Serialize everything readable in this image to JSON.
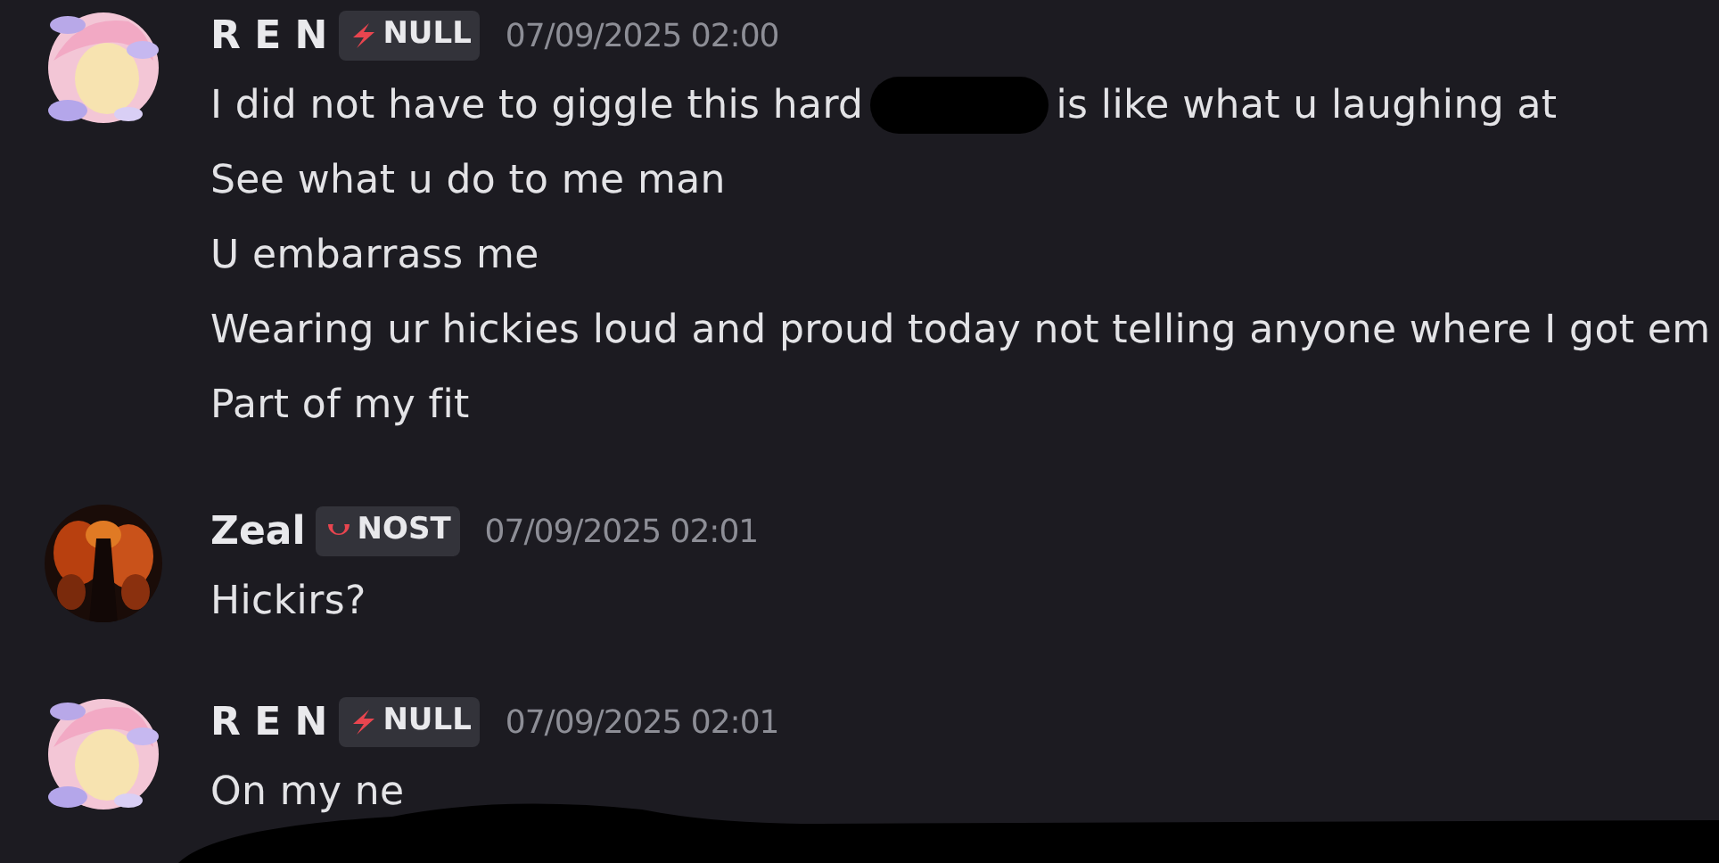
{
  "messages": [
    {
      "author": "R E N",
      "badge": {
        "kind": "lightning",
        "label": "NULL"
      },
      "timestamp": "07/09/2025 02:00",
      "lines": [
        [
          {
            "kind": "text",
            "text": "I did not have to giggle this hard"
          },
          {
            "kind": "redaction"
          },
          {
            "kind": "text",
            "text": "is like what u laughing at"
          }
        ],
        [
          {
            "kind": "text",
            "text": "See what u do to me man"
          }
        ],
        [
          {
            "kind": "text",
            "text": "U embarrass me"
          }
        ],
        [
          {
            "kind": "text",
            "text": "Wearing ur hickies loud and proud today not telling anyone where I got em"
          }
        ],
        [
          {
            "kind": "text",
            "text": "Part of my fit"
          }
        ]
      ]
    },
    {
      "author": "Zeal",
      "badge": {
        "kind": "crescent",
        "label": "NOST"
      },
      "timestamp": "07/09/2025 02:01",
      "lines": [
        [
          {
            "kind": "text",
            "text": "Hickirs?"
          }
        ]
      ]
    },
    {
      "author": "R E N",
      "badge": {
        "kind": "lightning",
        "label": "NULL"
      },
      "timestamp": "07/09/2025 02:01",
      "lines": [
        [
          {
            "kind": "text",
            "text": "On my ne"
          }
        ]
      ]
    }
  ],
  "bottom_redaction": true
}
